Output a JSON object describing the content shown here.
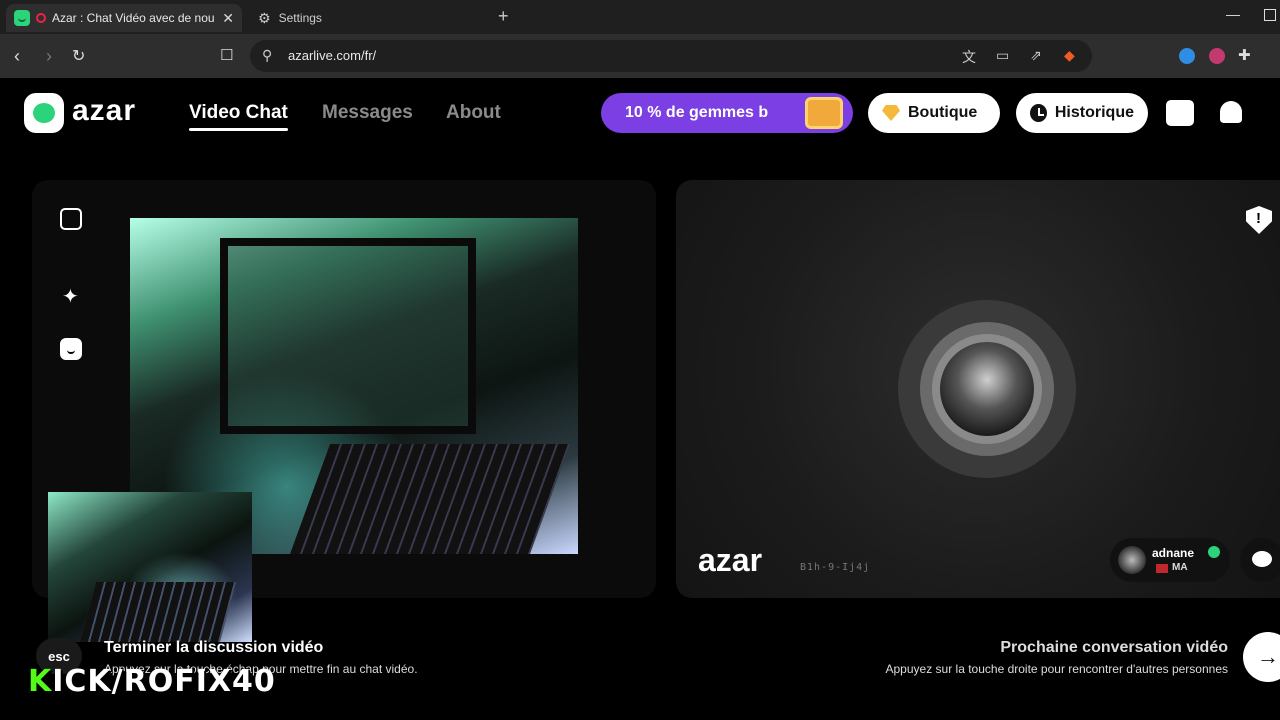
{
  "browser": {
    "tabs": [
      {
        "title": "Azar : Chat Vidéo avec de nou",
        "close": "✕"
      },
      {
        "title": "Settings"
      }
    ],
    "new_tab": "+",
    "url": "azarlive.com/fr/",
    "window_min": "—"
  },
  "header": {
    "logo": "azar",
    "nav": [
      "Video Chat",
      "Messages",
      "About"
    ],
    "promo": "10 % de gemmes b",
    "shop": "Boutique",
    "history": "Historique"
  },
  "right_panel": {
    "logo": "azar",
    "code": "B1h-9-Ij4j",
    "user": {
      "name": "adnane",
      "country": "MA"
    }
  },
  "hints": {
    "esc_key": "esc",
    "end_title": "Terminer la discussion vidéo",
    "end_desc": "Appuyez sur la touche échap pour mettre fin au chat vidéo.",
    "next_title": "Prochaine conversation vidéo",
    "next_desc": "Appuyez sur la touche droite pour rencontrer d'autres personnes",
    "next_arrow": "→"
  },
  "overlay": {
    "watermark_k": "K",
    "watermark_rest": "ICK/ROFIX40"
  },
  "colors": {
    "brand_green": "#2bd47a",
    "promo_purple": "#7b3fe4",
    "kick_green": "#53fc18"
  },
  "icons": [
    "back-arrow-icon",
    "forward-arrow-icon",
    "reload-icon",
    "bookmark-icon",
    "site-info-icon",
    "translate-icon",
    "cast-icon",
    "share-icon",
    "brave-shield-icon",
    "extensions-icon",
    "settings-gear-icon",
    "minimize-screen-icon",
    "magic-wand-icon",
    "face-sticker-icon",
    "shop-box-icon",
    "bell-icon",
    "report-icon",
    "chat-bubble-icon",
    "next-arrow-icon"
  ]
}
